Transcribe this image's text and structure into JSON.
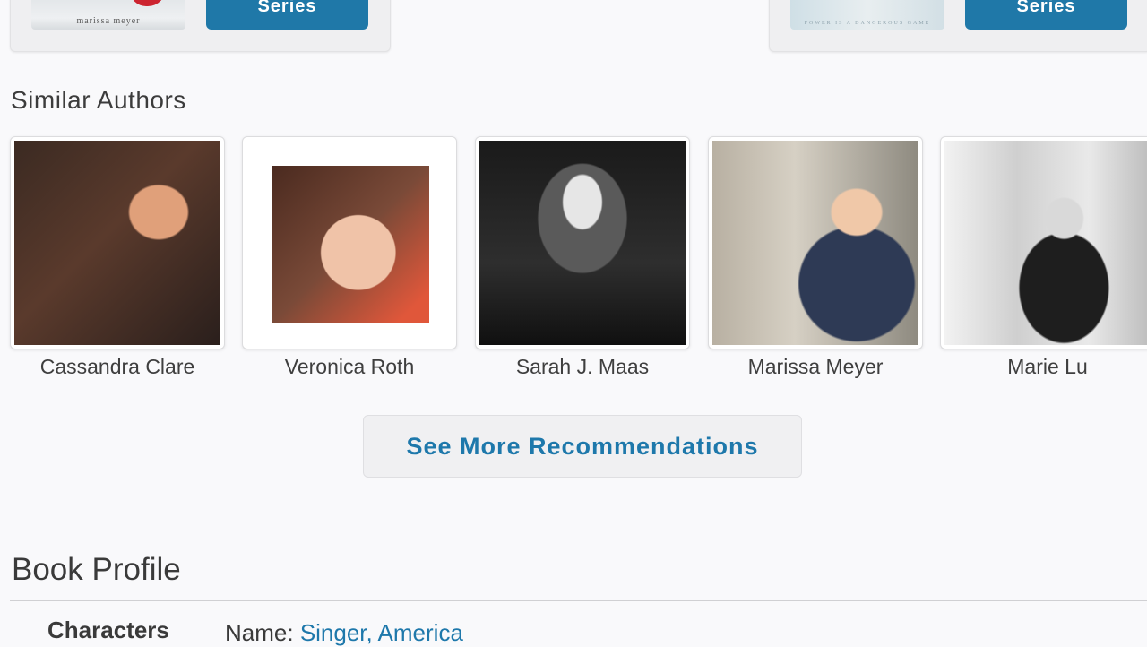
{
  "top_cards": [
    {
      "cover_text": "marissa meyer",
      "button_label": "Series"
    },
    {
      "cover_text": "POWER IS A DANGEROUS GAME",
      "button_label": "Series"
    }
  ],
  "similar_authors": {
    "title": "Similar Authors",
    "authors": [
      {
        "name": "Cassandra Clare"
      },
      {
        "name": "Veronica Roth"
      },
      {
        "name": "Sarah J. Maas"
      },
      {
        "name": "Marissa Meyer"
      },
      {
        "name": "Marie Lu"
      }
    ]
  },
  "see_more_label": "See More Recommendations",
  "book_profile": {
    "title": "Book Profile",
    "characters_label": "Characters",
    "name_prefix": "Name:",
    "name_value": "Singer, America"
  },
  "colors": {
    "accent": "#1e78ab",
    "button": "#1f78a8"
  }
}
